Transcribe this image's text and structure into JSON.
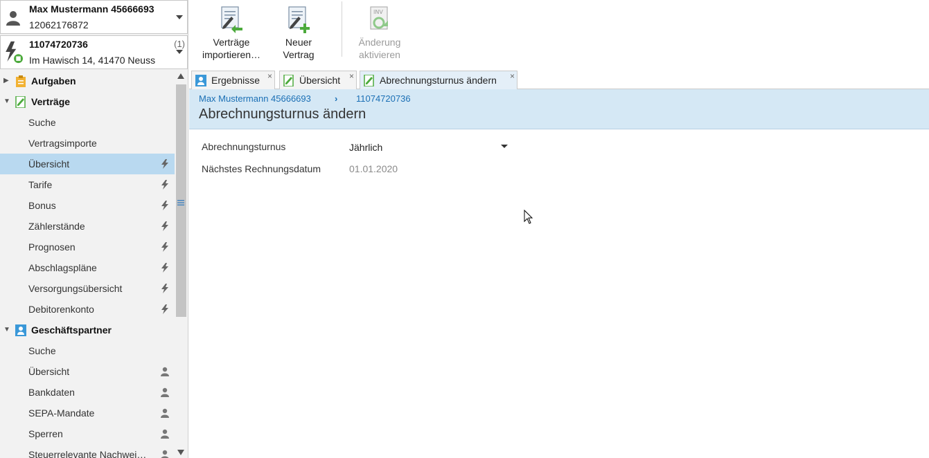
{
  "context": {
    "customer": {
      "name": "Max Mustermann 45666693",
      "number": "12062176872"
    },
    "contract": {
      "number": "11074720736",
      "address": "Im Hawisch 14, 41470 Neuss",
      "count": "(1)"
    }
  },
  "nav": {
    "sections": [
      {
        "label": "Aufgaben",
        "icon": "clipboard-icon",
        "expanded": false
      },
      {
        "label": "Verträge",
        "icon": "contract-icon",
        "expanded": true
      },
      {
        "label": "Geschäftspartner",
        "icon": "people-icon",
        "expanded": true
      }
    ],
    "vertraege_items": [
      {
        "label": "Suche"
      },
      {
        "label": "Vertragsimporte"
      },
      {
        "label": "Übersicht",
        "icon": "lightning-icon",
        "selected": true
      },
      {
        "label": "Tarife",
        "icon": "lightning-icon"
      },
      {
        "label": "Bonus",
        "icon": "lightning-icon"
      },
      {
        "label": "Zählerstände",
        "icon": "lightning-icon"
      },
      {
        "label": "Prognosen",
        "icon": "lightning-icon"
      },
      {
        "label": "Abschlagspläne",
        "icon": "lightning-icon"
      },
      {
        "label": "Versorgungsübersicht",
        "icon": "lightning-icon"
      },
      {
        "label": "Debitorenkonto",
        "icon": "lightning-icon"
      }
    ],
    "partner_items": [
      {
        "label": "Suche"
      },
      {
        "label": "Übersicht",
        "icon": "person-icon"
      },
      {
        "label": "Bankdaten",
        "icon": "person-icon"
      },
      {
        "label": "SEPA-Mandate",
        "icon": "person-icon"
      },
      {
        "label": "Sperren",
        "icon": "person-icon"
      },
      {
        "label": "Steuerrelevante Nachwei…",
        "icon": "person-icon"
      }
    ]
  },
  "toolbar": {
    "import_line1": "Verträge",
    "import_line2": "importieren…",
    "new_line1": "Neuer",
    "new_line2": "Vertrag",
    "activate_line1": "Änderung",
    "activate_line2": "aktivieren"
  },
  "tabs": [
    {
      "label": "Ergebnisse",
      "active": false
    },
    {
      "label": "Übersicht",
      "active": false
    },
    {
      "label": "Abrechnungsturnus ändern",
      "active": true
    }
  ],
  "tab_close": "×",
  "content": {
    "breadcrumb": [
      "Max Mustermann 45666693",
      "11074720736"
    ],
    "breadcrumb_sep": "›",
    "title": "Abrechnungsturnus ändern",
    "fields": {
      "turnus_label": "Abrechnungsturnus",
      "turnus_value": "Jährlich",
      "date_label": "Nächstes Rechnungsdatum",
      "date_value": "01.01.2020"
    }
  },
  "colors": {
    "accent": "#1a6fb5",
    "selection": "#b9d9f0",
    "header_band": "#d5e8f5",
    "green_icon": "#4caa3c"
  }
}
